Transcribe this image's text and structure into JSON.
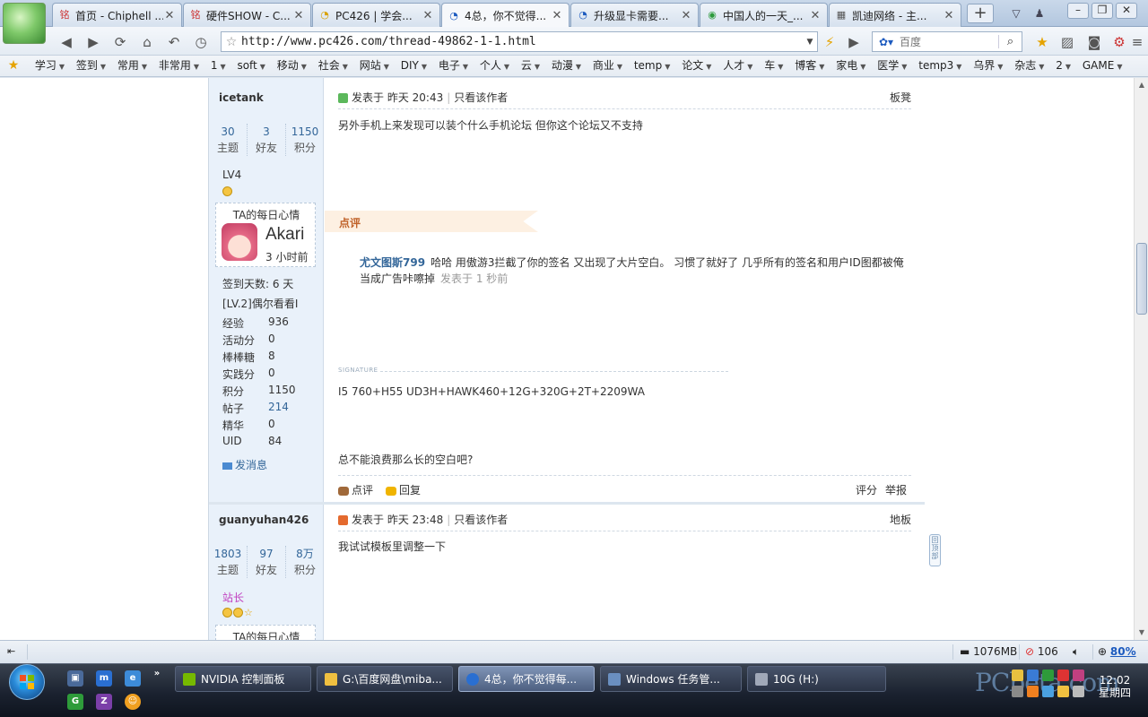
{
  "tabs": [
    {
      "label": "首页 - Chiphell ...",
      "favicon": "chiphell-icon",
      "active": false
    },
    {
      "label": "硬件SHOW - C...",
      "favicon": "chiphell-icon",
      "active": false
    },
    {
      "label": "PC426 | 学会...",
      "favicon": "pc426-icon",
      "active": false
    },
    {
      "label": "4总，你不觉得...",
      "favicon": "loading-icon",
      "active": true
    },
    {
      "label": "升级显卡需要...",
      "favicon": "loading-icon",
      "active": false
    },
    {
      "label": "中国人的一天_...",
      "favicon": "chrome-icon",
      "active": false
    },
    {
      "label": "凯迪网络 - 主...",
      "favicon": "kdnet-icon",
      "active": false
    }
  ],
  "address": {
    "url": "http://www.pc426.com/thread-49862-1-1.html"
  },
  "search": {
    "placeholder": "百度"
  },
  "bookmarks": [
    "学习",
    "签到",
    "常用",
    "非常用",
    "1",
    "soft",
    "移动",
    "社会",
    "网站",
    "DIY",
    "电子",
    "个人",
    "云",
    "动漫",
    "商业",
    "temp",
    "论文",
    "人才",
    "车",
    "博客",
    "家电",
    "医学",
    "temp3",
    "乌界",
    "杂志",
    "2",
    "GAME"
  ],
  "post1": {
    "author": "icetank",
    "stats": [
      {
        "num": "30",
        "label": "主题"
      },
      {
        "num": "3",
        "label": "好友"
      },
      {
        "num": "1150",
        "label": "积分"
      }
    ],
    "level": "LV4",
    "mood": {
      "title": "TA的每日心情",
      "name": "Akari",
      "time": "3 小时前"
    },
    "checkin": "签到天数: 6 天",
    "rank": "[LV.2]偶尔看看I",
    "props": [
      {
        "key": "经验",
        "value": "936"
      },
      {
        "key": "活动分",
        "value": "0"
      },
      {
        "key": "棒棒糖",
        "value": "8"
      },
      {
        "key": "实践分",
        "value": "0"
      },
      {
        "key": "积分",
        "value": "1150"
      },
      {
        "key": "帖子",
        "value": "214"
      },
      {
        "key": "精华",
        "value": "0"
      },
      {
        "key": "UID",
        "value": "84"
      }
    ],
    "pm": "发消息",
    "posted": "发表于 昨天 20:43",
    "author_only": "只看该作者",
    "floor": "板凳",
    "body": "另外手机上来发现可以装个什么手机论坛 但你这个论坛又不支持",
    "rate_title": "点评",
    "comment": {
      "user": "尤文图斯799",
      "text": "哈哈 用傲游3拦截了你的签名 又出现了大片空白。 习惯了就好了 几乎所有的签名和用户ID图都被俺当成广告咔嚓掉",
      "time": "发表于 1 秒前"
    },
    "sig_label": "SIGNATURE",
    "signature": "I5 760+H55 UD3H+HAWK460+12G+320G+2T+2209WA",
    "extra": "总不能浪费那么长的空白吧?",
    "foot": {
      "comment": "点评",
      "reply": "回复",
      "rate": "评分",
      "report": "举报"
    }
  },
  "post2": {
    "author": "guanyuhan426",
    "stats": [
      {
        "num": "1803",
        "label": "主题"
      },
      {
        "num": "97",
        "label": "好友"
      },
      {
        "num": "8万",
        "label": "积分"
      }
    ],
    "level": "站长",
    "mood_title": "TA的每日心情",
    "posted": "发表于 昨天 23:48",
    "author_only": "只看该作者",
    "floor": "地板",
    "body": "我试试模板里调整一下"
  },
  "back_top": "回顶部",
  "status": {
    "memory": "1076MB",
    "blocked": "106",
    "zoom": "80%"
  },
  "taskbar": {
    "tasks": [
      "NVIDIA 控制面板",
      "G:\\百度网盘\\miba...",
      "4总，你不觉得每...",
      "Windows 任务管...",
      "10G (H:)"
    ],
    "time": "12:02",
    "day": "星期四"
  },
  "colors": {
    "accent": "#336699",
    "rate_band": "#fdf0e2",
    "sidebar": "#e9f1fa"
  }
}
